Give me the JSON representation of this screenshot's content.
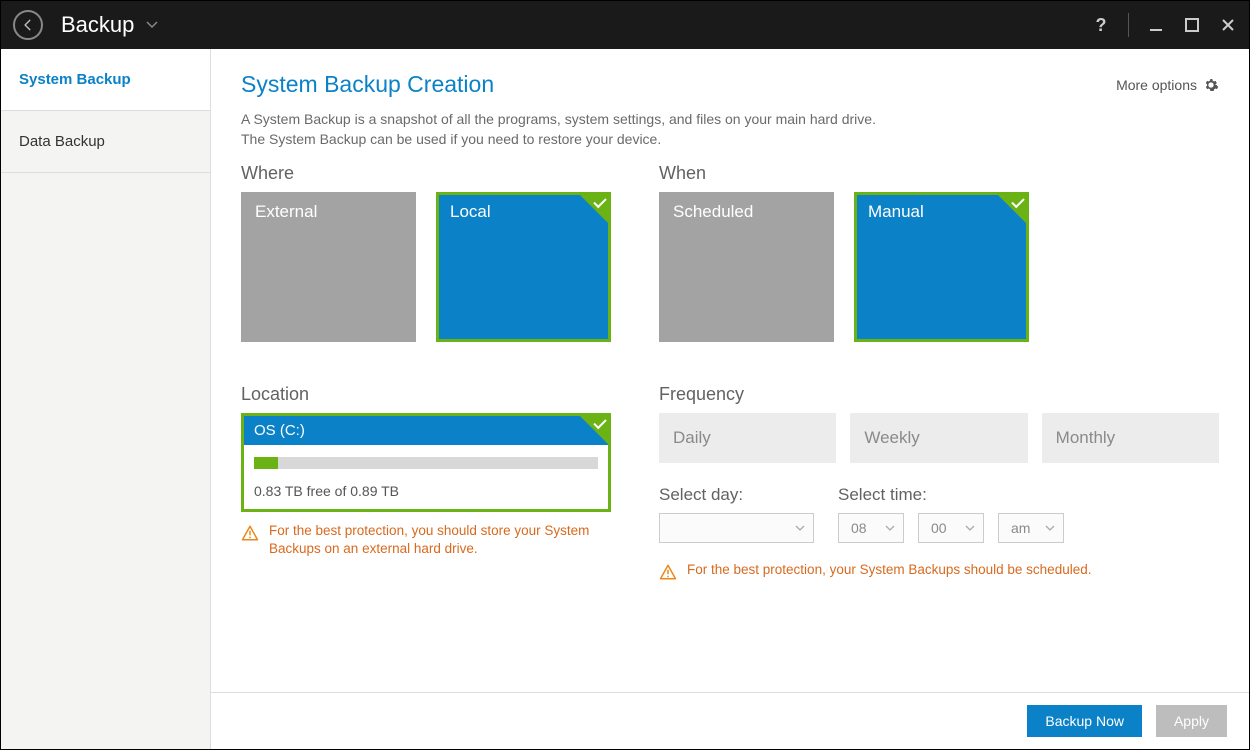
{
  "titlebar": {
    "title": "Backup"
  },
  "sidebar": {
    "items": [
      {
        "label": "System Backup"
      },
      {
        "label": "Data Backup"
      }
    ]
  },
  "header": {
    "page_title": "System Backup Creation",
    "more_options": "More options"
  },
  "description": {
    "line1": "A System Backup is a snapshot of all the programs, system settings, and files on your main hard drive.",
    "line2": "The System Backup can be used if you need to restore your device."
  },
  "where": {
    "label": "Where",
    "options": [
      {
        "label": "External",
        "selected": false
      },
      {
        "label": "Local",
        "selected": true
      }
    ]
  },
  "when": {
    "label": "When",
    "options": [
      {
        "label": "Scheduled",
        "selected": false
      },
      {
        "label": "Manual",
        "selected": true
      }
    ]
  },
  "location": {
    "label": "Location",
    "drive_name": "OS (C:)",
    "free_text": "0.83 TB free of 0.89 TB",
    "fill_percent": 7,
    "warning": "For the best protection, you should store your System Backups on an external hard drive."
  },
  "frequency": {
    "label": "Frequency",
    "options": [
      "Daily",
      "Weekly",
      "Monthly"
    ],
    "select_day_label": "Select day:",
    "select_time_label": "Select time:",
    "day_value": "",
    "hour": "08",
    "minute": "00",
    "ampm": "am",
    "warning": "For the best protection, your System Backups should be scheduled."
  },
  "footer": {
    "backup_now": "Backup Now",
    "apply": "Apply"
  }
}
